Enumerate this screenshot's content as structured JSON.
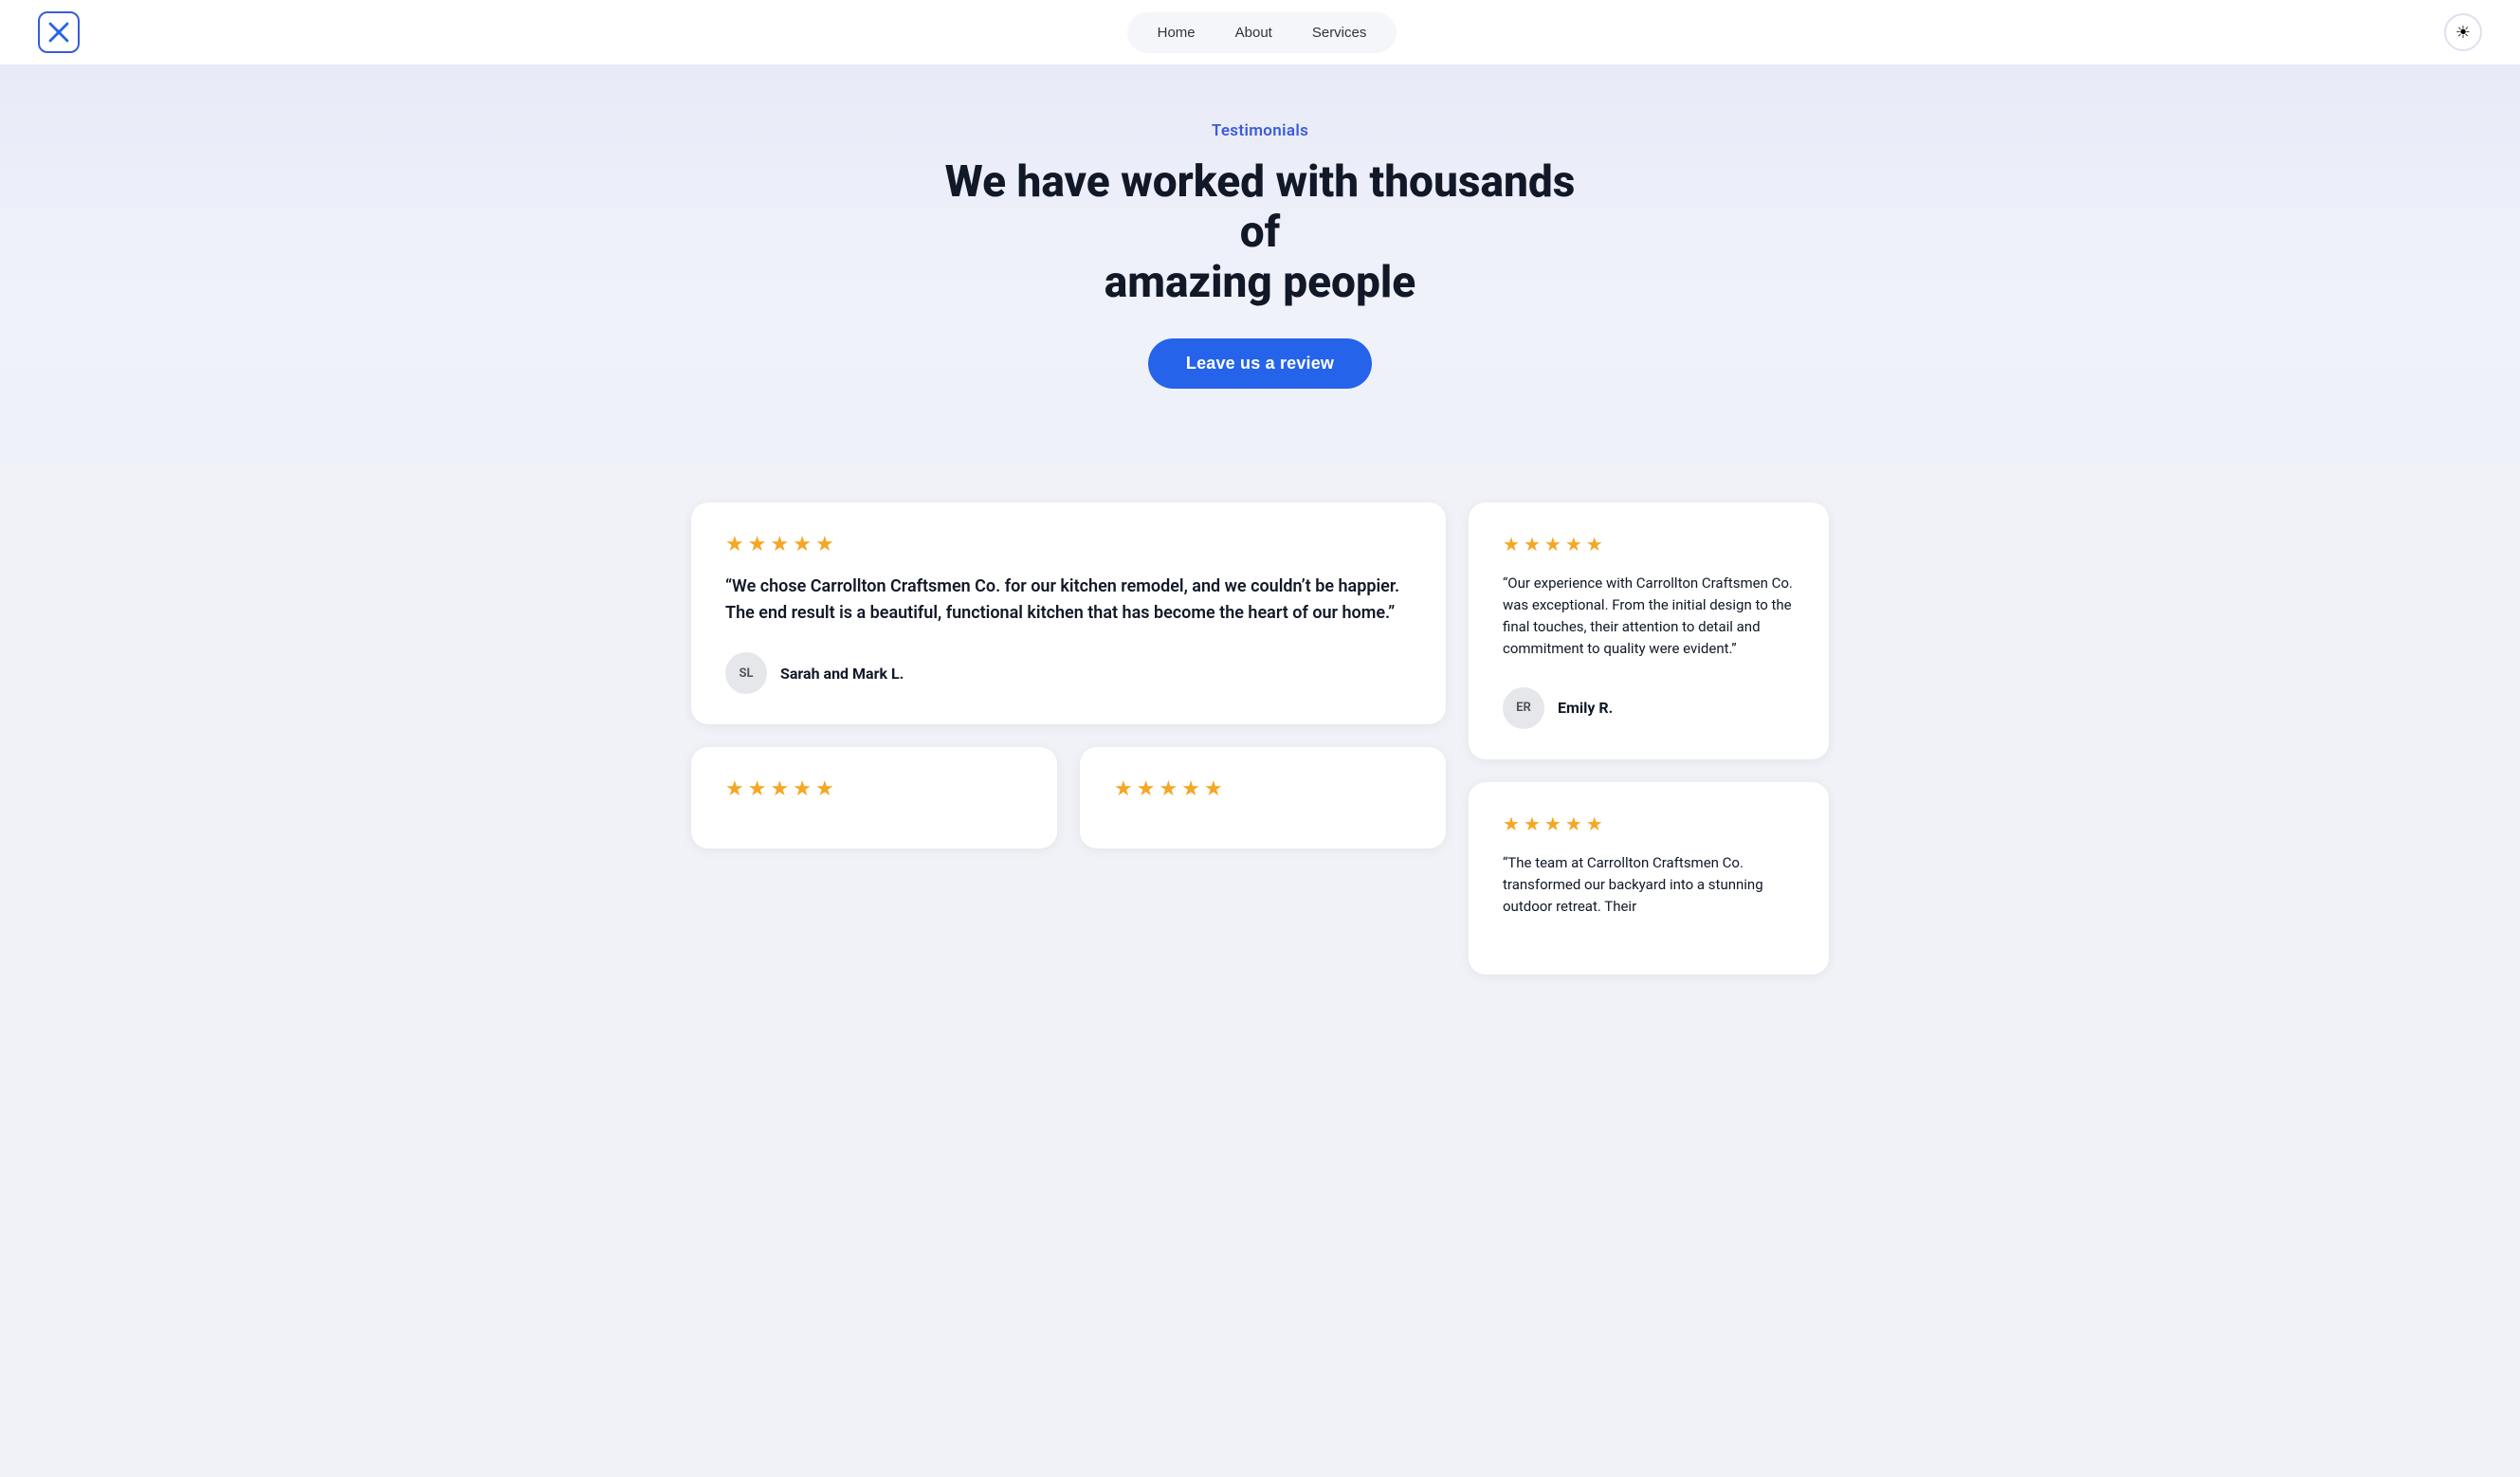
{
  "navbar": {
    "logo_alt": "Carrollton Craftsmen Co.",
    "nav_items": [
      "Home",
      "About",
      "Services"
    ],
    "theme_icon": "☀"
  },
  "hero": {
    "section_label": "Testimonials",
    "title_line1": "We have worked with thousands of",
    "title_line2": "amazing people",
    "cta_button": "Leave us a review"
  },
  "reviews": {
    "main_review": {
      "stars": 5,
      "text": "“We chose Carrollton Craftsmen Co. for our kitchen remodel, and we couldn’t be happier. The end result is a beautiful, functional kitchen that has become the heart of our home.”",
      "avatar_initials": "SL",
      "reviewer_name": "Sarah and Mark L."
    },
    "right_reviews": [
      {
        "stars": 5,
        "text": "“Our experience with Carrollton Craftsmen Co. was exceptional. From the initial design to the final touches, their attention to detail and commitment to quality were evident.”",
        "avatar_initials": "ER",
        "reviewer_name": "Emily R."
      },
      {
        "stars": 5,
        "text": "“The team at Carrollton Craftsmen Co. transformed our backyard into a stunning outdoor retreat. Their",
        "avatar_initials": "",
        "reviewer_name": ""
      }
    ],
    "bottom_reviews": [
      {
        "stars": 5,
        "text": "",
        "avatar_initials": "",
        "reviewer_name": ""
      },
      {
        "stars": 5,
        "text": "",
        "avatar_initials": "",
        "reviewer_name": ""
      }
    ]
  },
  "star_color": "#f5a623"
}
